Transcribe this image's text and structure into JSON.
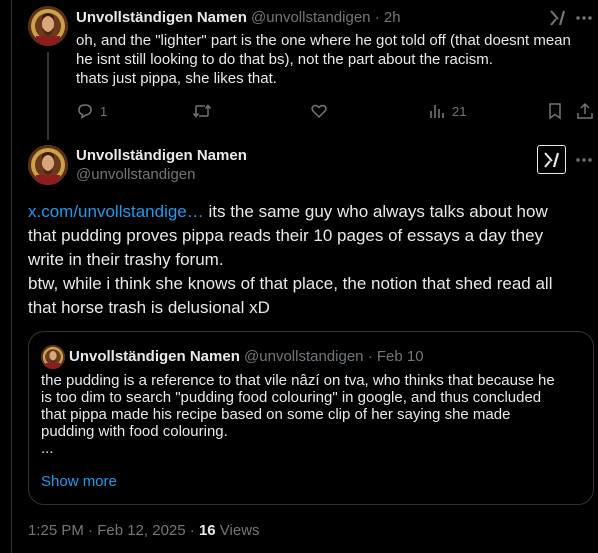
{
  "tweet1": {
    "display_name": "Unvollständigen Namen",
    "handle": "@unvollstandigen",
    "time": "· 2h",
    "text_lines": [
      "oh, and the \"lighter\" part is the one where he got told off (that doesnt mean",
      "he isnt still looking to do that bs), not the part about the racism.",
      "thats just pippa, she likes that."
    ],
    "replies": "1",
    "views": "21"
  },
  "tweet2": {
    "display_name": "Unvollständigen Namen",
    "handle": "@unvollstandigen",
    "link_text": "x.com/unvollstandige…",
    "text_lines": [
      " its the same guy who always talks about how",
      "that pudding proves pippa reads their 10 pages of essays a day they",
      "write in their trashy forum.",
      "btw, while i think she knows of that place, the notion that shed read all",
      "that horse trash is delusional xD"
    ]
  },
  "quote": {
    "display_name": "Unvollständigen Namen",
    "handle": "@unvollstandigen",
    "date": "· Feb 10",
    "text_lines": [
      "the pudding is a reference to that vile nâzí on tva, who thinks that because he",
      "is too dim to search \"pudding food colouring\" in google, and thus concluded",
      "that pippa made his recipe based on some clip of her saying she made",
      "pudding with food colouring.",
      "..."
    ],
    "show_more": "Show more"
  },
  "footer": {
    "timestamp": "1:25 PM · Feb 12, 2025 ·",
    "views_count": "16",
    "views_label": "Views"
  },
  "colors": {
    "background": "#000000",
    "text": "#e7e9ea",
    "muted": "#71767b",
    "link": "#1d9bf0",
    "border": "#2f3336"
  }
}
